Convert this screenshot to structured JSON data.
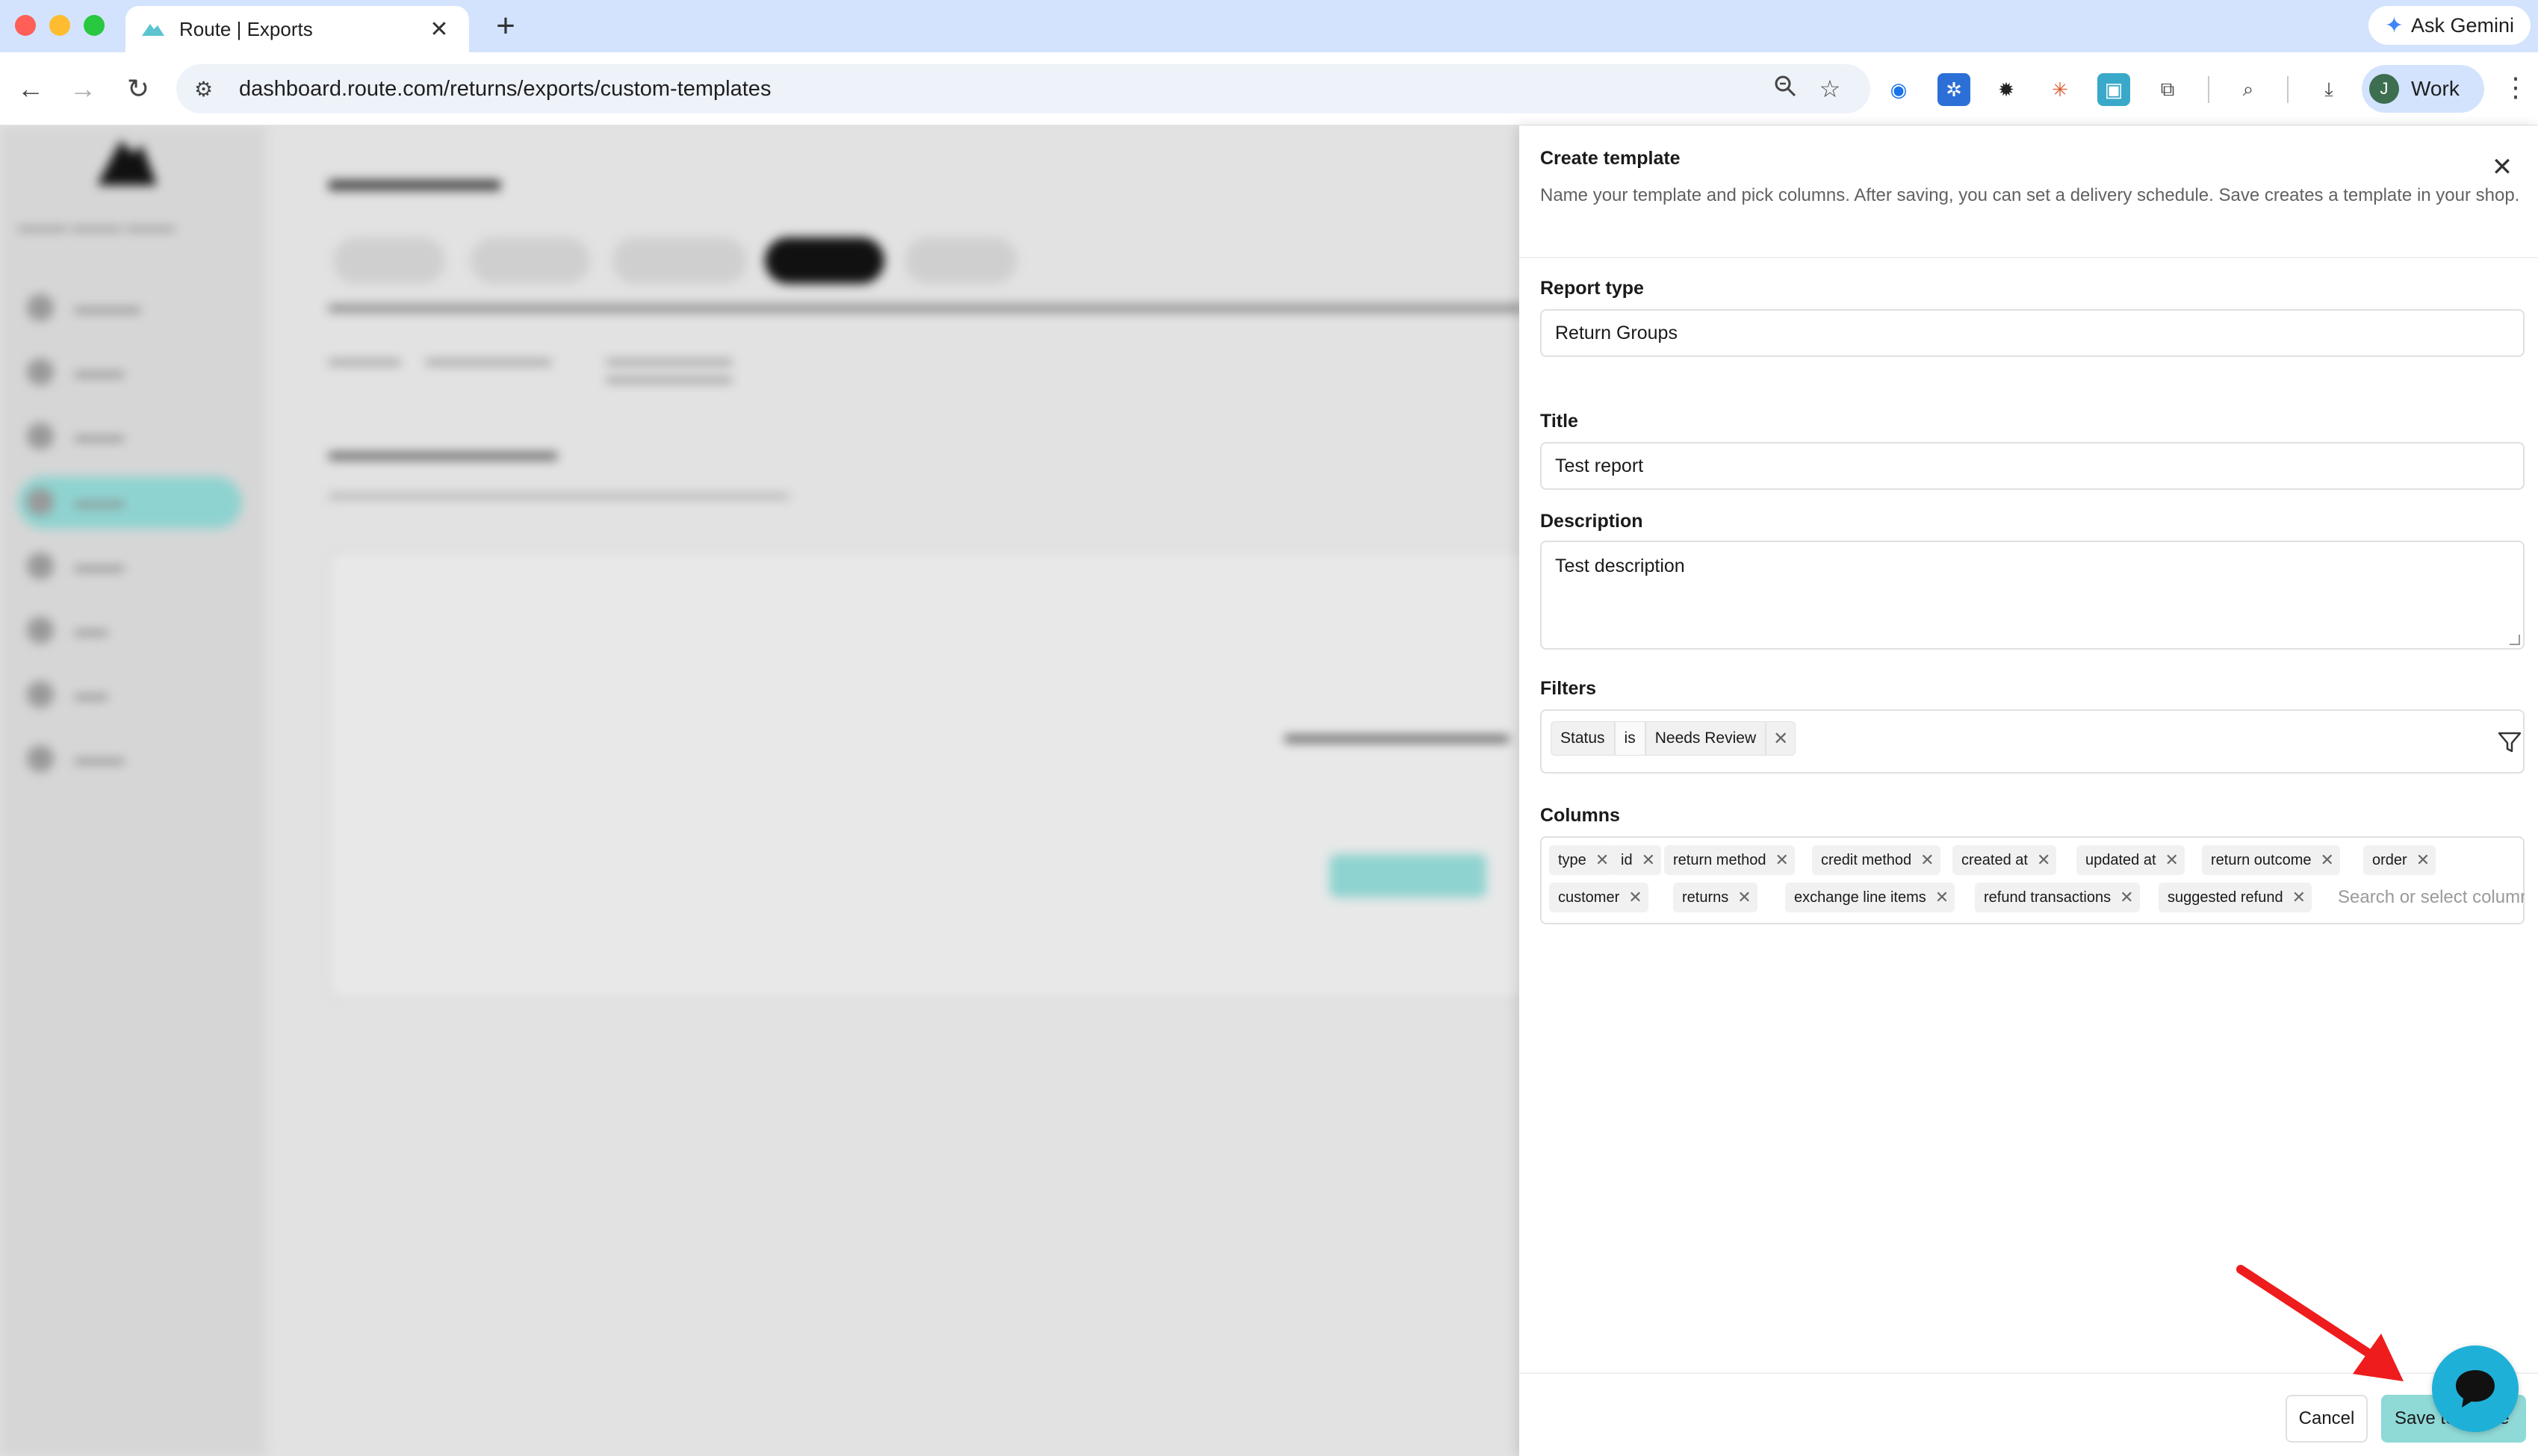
{
  "browser": {
    "tab_title": "Route | Exports",
    "new_tab_symbol": "+",
    "close_symbol": "✕",
    "url": "dashboard.route.com/returns/exports/custom-templates",
    "ask_gemini": "Ask Gemini",
    "profile_initial": "J",
    "profile_label": "Work"
  },
  "drawer": {
    "title": "Create template",
    "subtitle": "Name your template and pick columns. After saving, you can set a delivery schedule. Save creates a template in your shop.",
    "close_symbol": "✕",
    "report_type_label": "Report type",
    "report_type_value": "Return Groups",
    "title_label": "Title",
    "title_value": "Test report",
    "description_label": "Description",
    "description_value": "Test description",
    "filters_label": "Filters",
    "filter": {
      "field": "Status",
      "operator": "is",
      "value": "Needs Review"
    },
    "columns_label": "Columns",
    "columns": [
      "type",
      "id",
      "return method",
      "credit method",
      "created at",
      "updated at",
      "return outcome",
      "order",
      "customer",
      "returns",
      "exchange line items",
      "refund transactions",
      "suggested refund"
    ],
    "columns_search_placeholder": "Search or select columns",
    "cancel_label": "Cancel",
    "save_label": "Save template"
  },
  "colors": {
    "accent": "#8fd9d7",
    "chat": "#1fb0d8",
    "annotation_arrow": "#ee1c1c"
  }
}
